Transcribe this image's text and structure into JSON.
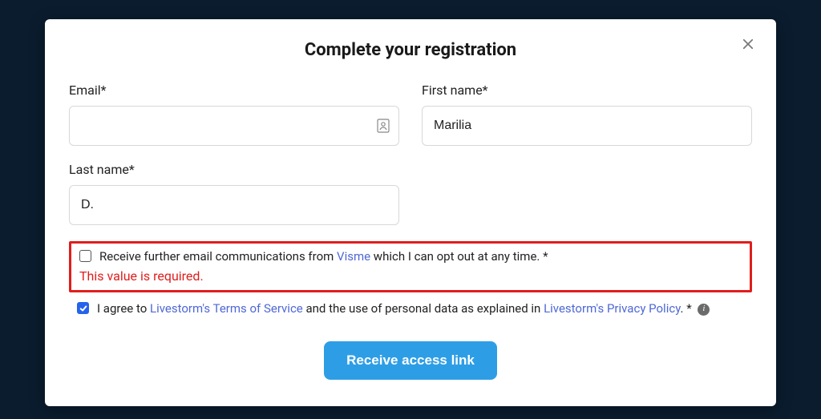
{
  "modal": {
    "title": "Complete your registration",
    "fields": {
      "email": {
        "label": "Email*",
        "value": ""
      },
      "first_name": {
        "label": "First name*",
        "value": "Marilia"
      },
      "last_name": {
        "label": "Last name*",
        "value": "D."
      }
    },
    "consent_email": {
      "pre": "Receive further email communications from ",
      "brand": "Visme",
      "post": " which I can opt out at any time. *",
      "checked": false,
      "error": "This value is required."
    },
    "consent_terms": {
      "pre": "I agree to ",
      "tos_link": "Livestorm's Terms of Service",
      "mid": " and the use of personal data as explained in ",
      "privacy_link": "Livestorm's Privacy Policy",
      "post": ". * ",
      "checked": true
    },
    "submit_label": "Receive access link"
  }
}
